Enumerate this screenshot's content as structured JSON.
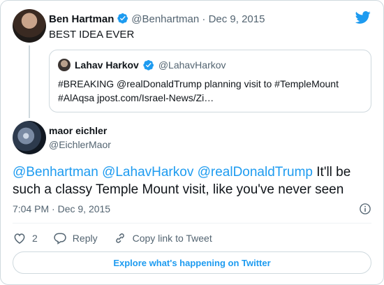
{
  "colors": {
    "accent": "#1d9bf0",
    "text": "#0f1419",
    "muted": "#536471",
    "border": "#cfd9de"
  },
  "first_tweet": {
    "name": "Ben Hartman",
    "handle": "@Benhartman",
    "separator": " · ",
    "date": "Dec 9, 2015",
    "text": "BEST IDEA EVER",
    "verified": true
  },
  "quoted_tweet": {
    "name": "Lahav Harkov",
    "handle": "@LahavHarkov",
    "line1": "#BREAKING @realDonaldTrump planning visit to #TempleMount",
    "line2": "#AlAqsa jpost.com/Israel-News/Zi…",
    "verified": true
  },
  "main_tweet": {
    "name": "maor eichler",
    "handle": "@EichlerMaor",
    "mentions": [
      "@Benhartman",
      "@LahavHarkov",
      "@realDonaldTrump"
    ],
    "text_after_mentions": "It'll be such a classy Temple Mount visit, like you've never seen",
    "time": "7:04 PM",
    "separator": " · ",
    "date": "Dec 9, 2015"
  },
  "actions": {
    "like_count": "2",
    "reply_label": "Reply",
    "copy_label": "Copy link to Tweet"
  },
  "explore_label": "Explore what's happening on Twitter",
  "icons": [
    "twitter-logo-icon",
    "verified-badge-icon",
    "info-icon",
    "heart-icon",
    "reply-icon",
    "link-icon"
  ]
}
